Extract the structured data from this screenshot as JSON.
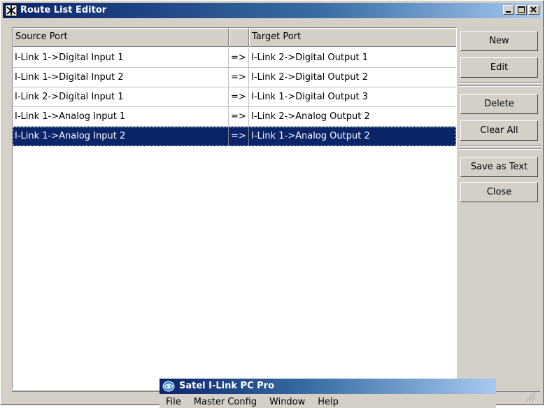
{
  "window": {
    "title": "Route List Editor"
  },
  "table": {
    "columns": [
      "Source Port",
      "",
      "Target Port"
    ],
    "rows": [
      {
        "source": "I-Link 1->Digital Input 1",
        "arrow": "=>",
        "target": "I-Link 2->Digital Output 1"
      },
      {
        "source": "I-Link 1->Digital Input 2",
        "arrow": "=>",
        "target": "I-Link 2->Digital Output 2"
      },
      {
        "source": "I-Link 2->Digital Input 1",
        "arrow": "=>",
        "target": "I-Link 1->Digital Output 3"
      },
      {
        "source": "I-Link 1->Analog Input 1",
        "arrow": "=>",
        "target": "I-Link 2->Analog Output 2"
      },
      {
        "source": "I-Link 1->Analog Input 2",
        "arrow": "=>",
        "target": "I-Link 1->Analog Output 2"
      }
    ],
    "selected_row": 4
  },
  "buttons": {
    "new": "New",
    "edit": "Edit",
    "delete": "Delete",
    "clear_all": "Clear All",
    "save_as_text": "Save as Text",
    "close": "Close"
  },
  "background_app": {
    "title": "Satel I-Link PC Pro",
    "menu": [
      "File",
      "Master Config",
      "Window",
      "Help"
    ]
  },
  "colors": {
    "titlebar": "#0a246a",
    "selection": "#0a246a",
    "face": "#d4d0c8"
  }
}
